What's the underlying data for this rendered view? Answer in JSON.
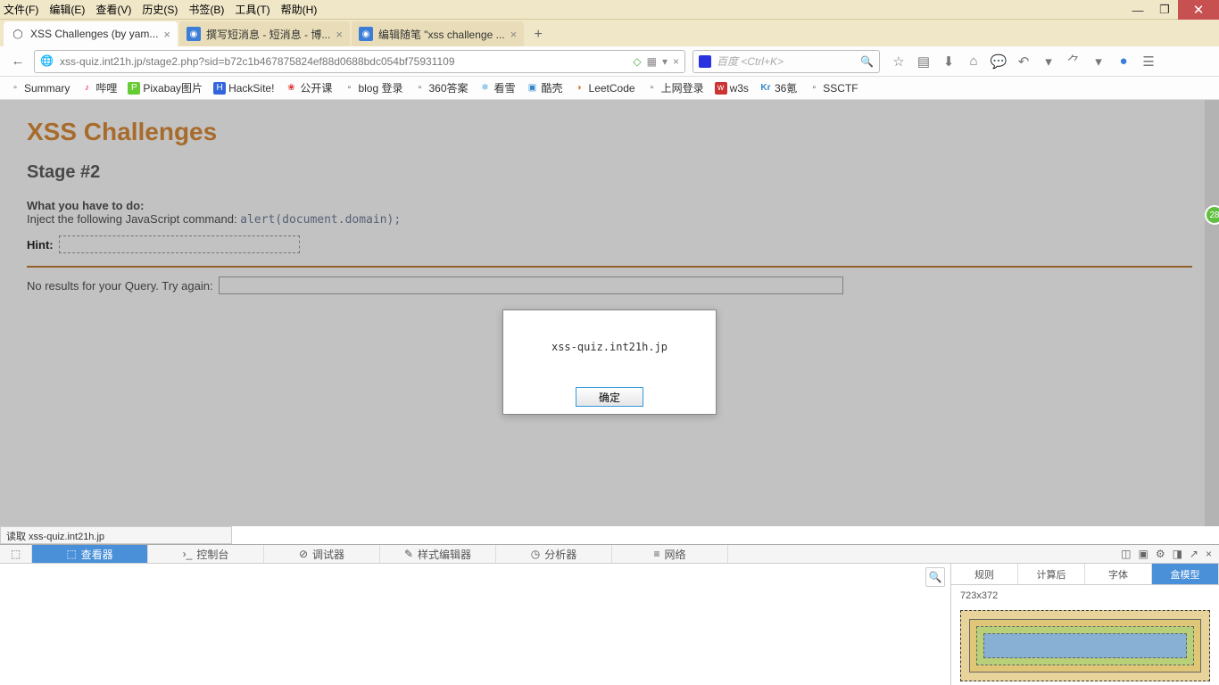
{
  "menu": {
    "file": "文件(F)",
    "edit": "编辑(E)",
    "view": "查看(V)",
    "history": "历史(S)",
    "bookmarks": "书签(B)",
    "tools": "工具(T)",
    "help": "帮助(H)"
  },
  "tabs": [
    {
      "title": "XSS Challenges (by yam...",
      "active": true
    },
    {
      "title": "撰写短消息 - 短消息 - 博...",
      "active": false
    },
    {
      "title": "编辑随笔 \"xss challenge ...",
      "active": false
    }
  ],
  "url": "xss-quiz.int21h.jp/stage2.php?sid=b72c1b467875824ef88d0688bdc054bf75931109",
  "search_placeholder": "百度 <Ctrl+K>",
  "bookmarks": [
    "Summary",
    "哔哩",
    "Pixabay图片",
    "HackSite!",
    "公开课",
    "blog 登录",
    "360答案",
    "看雪",
    "酷壳",
    "LeetCode",
    "上网登录",
    "w3s",
    "36氪",
    "SSCTF"
  ],
  "page": {
    "h1": "XSS Challenges",
    "h2": "Stage #2",
    "todo": "What you have to do:",
    "inject_text": "Inject the following JavaScript command: ",
    "inject_code": "alert(document.domain);",
    "hint_label": "Hint:",
    "noresults": "No results for your Query. Try again:"
  },
  "alert": {
    "message": "xss-quiz.int21h.jp",
    "ok": "确定"
  },
  "status": "读取 xss-quiz.int21h.jp",
  "badge": "28",
  "devtools": {
    "tabs": [
      "查看器",
      "控制台",
      "调试器",
      "样式编辑器",
      "分析器",
      "网络"
    ],
    "side_tabs": [
      "规则",
      "计算后",
      "字体",
      "盒模型"
    ],
    "dims": "723x372"
  }
}
